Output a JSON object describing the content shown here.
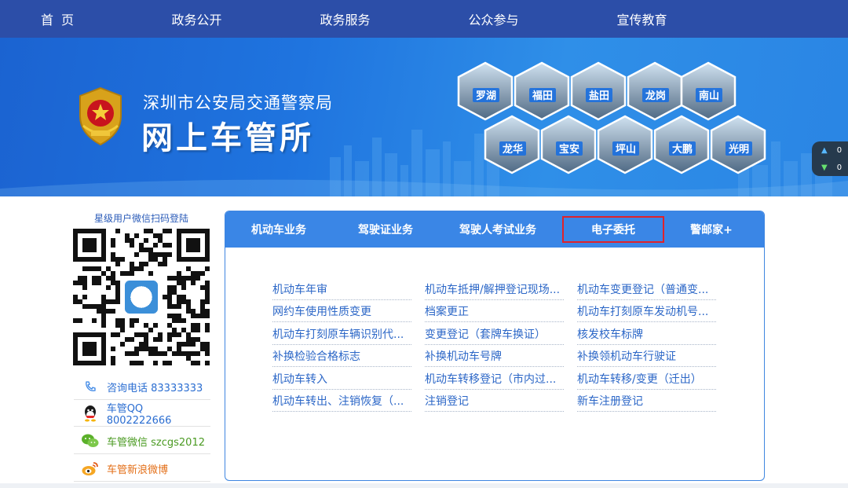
{
  "nav": [
    "首页",
    "政务公开",
    "政务服务",
    "公众参与",
    "宣传教育"
  ],
  "banner": {
    "bureau": "深圳市公安局交通警察局",
    "site_title": "网上车管所",
    "branches": [
      "罗湖",
      "福田",
      "盐田",
      "龙岗",
      "南山",
      "龙华",
      "宝安",
      "坪山",
      "大鹏",
      "光明"
    ],
    "widget_up": "0",
    "widget_down": "0"
  },
  "sidebar": {
    "qr_caption": "星级用户微信扫码登陆",
    "contacts": [
      {
        "icon": "phone-icon",
        "label": "咨询电话 83333333"
      },
      {
        "icon": "qq-icon",
        "label": "车管QQ 8002222666"
      },
      {
        "icon": "wechat-icon",
        "label": "车管微信 szcgs2012"
      },
      {
        "icon": "weibo-icon",
        "label": "车管新浪微博"
      }
    ]
  },
  "tabs": [
    "机动车业务",
    "驾驶证业务",
    "驾驶人考试业务",
    "电子委托",
    "警邮家+"
  ],
  "active_tab": "电子委托",
  "links": [
    "机动车年审",
    "机动车抵押/解押登记现场...",
    "机动车变更登记（普通变...",
    "网约车使用性质变更",
    "档案更正",
    "机动车打刻原车发动机号...",
    "机动车打刻原车辆识别代...",
    "变更登记（套牌车换证）",
    "核发校车标牌",
    "补换检验合格标志",
    "补换机动车号牌",
    "补换领机动车行驶证",
    "机动车转入",
    "机动车转移登记（市内过...",
    "机动车转移/变更（迁出）",
    "机动车转出、注销恢复（...",
    "注销登记",
    "新车注册登记"
  ],
  "colors": {
    "nav_bg": "#2c4ea8",
    "tab_bg": "#3a86e6",
    "highlight": "#e0222a",
    "link": "#2c67c7"
  }
}
